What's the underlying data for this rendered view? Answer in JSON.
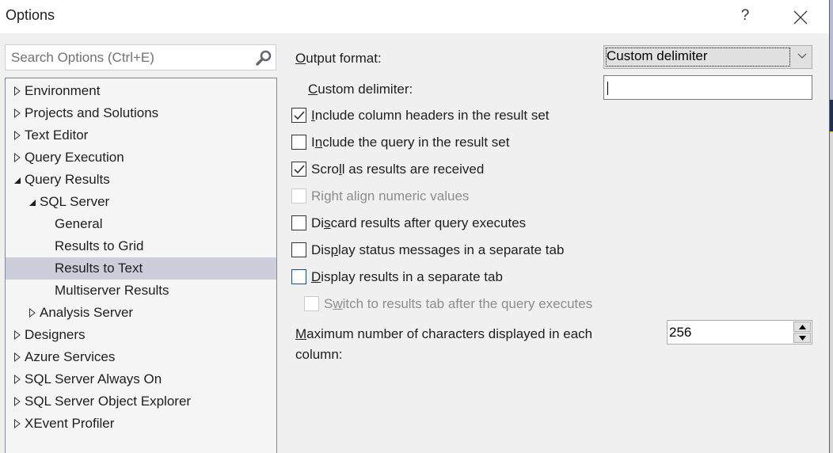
{
  "window": {
    "title": "Options",
    "help_label": "?",
    "close_icon": "close-icon"
  },
  "search": {
    "placeholder": "Search Options (Ctrl+E)",
    "value": "",
    "icon": "search-icon"
  },
  "tree": {
    "items": [
      {
        "label": "Environment",
        "level": 0,
        "state": "collapsed"
      },
      {
        "label": "Projects and Solutions",
        "level": 0,
        "state": "collapsed"
      },
      {
        "label": "Text Editor",
        "level": 0,
        "state": "collapsed"
      },
      {
        "label": "Query Execution",
        "level": 0,
        "state": "collapsed"
      },
      {
        "label": "Query Results",
        "level": 0,
        "state": "expanded"
      },
      {
        "label": "SQL Server",
        "level": 1,
        "state": "expanded"
      },
      {
        "label": "General",
        "level": 2,
        "state": "leaf"
      },
      {
        "label": "Results to Grid",
        "level": 2,
        "state": "leaf"
      },
      {
        "label": "Results to Text",
        "level": 2,
        "state": "leaf",
        "selected": true
      },
      {
        "label": "Multiserver Results",
        "level": 2,
        "state": "leaf"
      },
      {
        "label": "Analysis Server",
        "level": 1,
        "state": "collapsed"
      },
      {
        "label": "Designers",
        "level": 0,
        "state": "collapsed"
      },
      {
        "label": "Azure Services",
        "level": 0,
        "state": "collapsed"
      },
      {
        "label": "SQL Server Always On",
        "level": 0,
        "state": "collapsed"
      },
      {
        "label": "SQL Server Object Explorer",
        "level": 0,
        "state": "collapsed"
      },
      {
        "label": "XEvent Profiler",
        "level": 0,
        "state": "collapsed"
      }
    ]
  },
  "settings": {
    "output_format": {
      "label_accel": "O",
      "label_rest": "utput format:",
      "value": "Custom delimiter"
    },
    "custom_delimiter": {
      "label_accel": "C",
      "label_rest": "ustom delimiter:",
      "value": ""
    },
    "checkboxes": [
      {
        "pre": "",
        "accel": "I",
        "post": "nclude column headers in the result set",
        "checked": true,
        "enabled": true
      },
      {
        "pre": "I",
        "accel": "n",
        "post": "clude the query in the result set",
        "checked": false,
        "enabled": true
      },
      {
        "pre": "Scro",
        "accel": "l",
        "post": "l as results are received",
        "checked": true,
        "enabled": true
      },
      {
        "pre": "Ri",
        "accel": "g",
        "post": "ht align numeric values",
        "checked": false,
        "enabled": false
      },
      {
        "pre": "Di",
        "accel": "s",
        "post": "card results after query executes",
        "checked": false,
        "enabled": true
      },
      {
        "pre": "Dis",
        "accel": "p",
        "post": "lay status messages in a separate tab",
        "checked": false,
        "enabled": true
      },
      {
        "pre": "",
        "accel": "D",
        "post": "isplay results in a separate tab",
        "checked": false,
        "enabled": true,
        "hover": true
      },
      {
        "pre": "S",
        "accel": "w",
        "post": "itch to results tab after the query executes",
        "checked": false,
        "enabled": false
      }
    ],
    "max_chars": {
      "label_accel": "M",
      "label_line1_rest": "aximum number of characters displayed in each",
      "label_line2": "column:",
      "value": "256"
    }
  }
}
